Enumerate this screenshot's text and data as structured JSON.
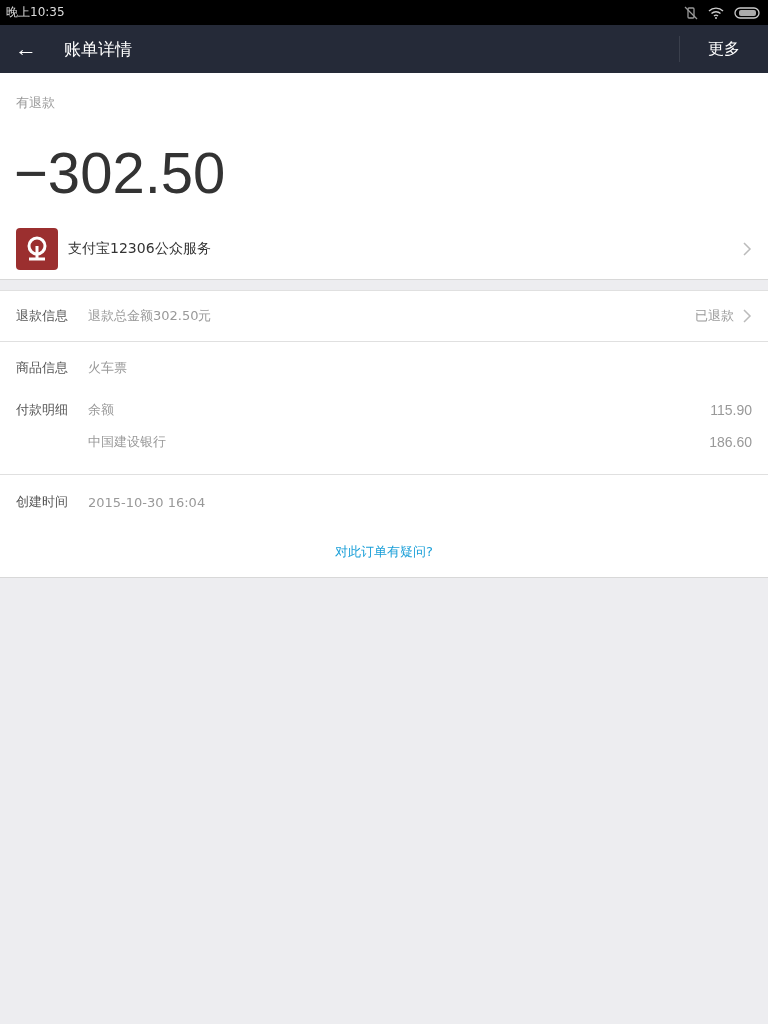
{
  "status_bar": {
    "time": "晚上10:35"
  },
  "nav": {
    "back": "←",
    "title": "账单详情",
    "more": "更多"
  },
  "summary": {
    "status": "有退款",
    "amount": "−302.50",
    "merchant": "支付宝12306公众服务"
  },
  "refund": {
    "label": "退款信息",
    "value": "退款总金额302.50元",
    "status": "已退款"
  },
  "goods": {
    "label": "商品信息",
    "value": "火车票"
  },
  "payment": {
    "label": "付款明细",
    "items": [
      {
        "name": "余额",
        "amount": "115.90"
      },
      {
        "name": "中国建设银行",
        "amount": "186.60"
      }
    ]
  },
  "created": {
    "label": "创建时间",
    "value": "2015-10-30 16:04"
  },
  "question_link": "对此订单有疑问?"
}
